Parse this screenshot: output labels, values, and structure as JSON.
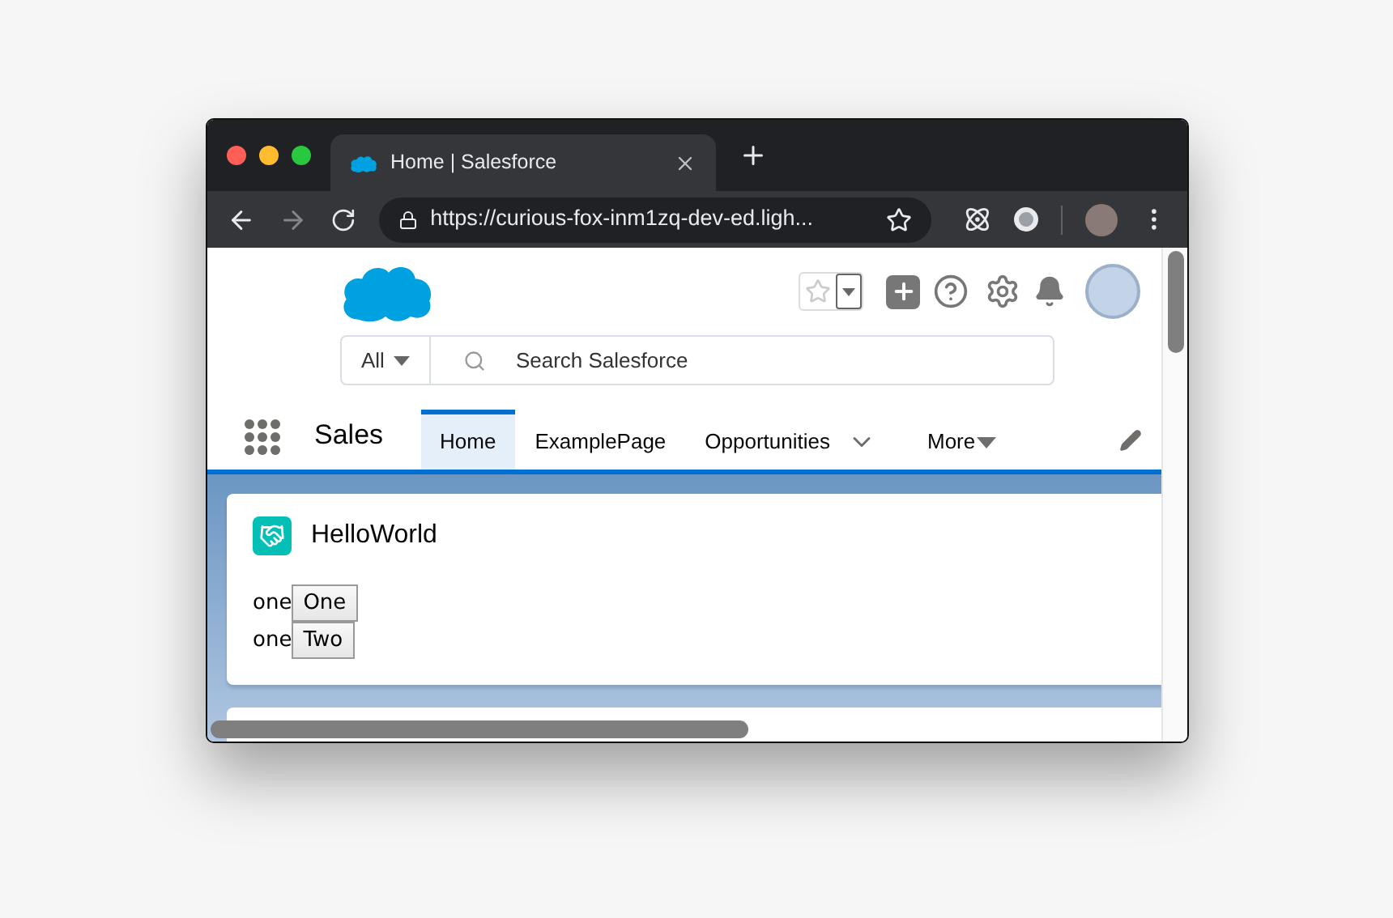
{
  "browser": {
    "tab": {
      "title": "Home | Salesforce",
      "selected": true
    },
    "address": "https://curious-fox-inm1zq-dev-ed.ligh..."
  },
  "header": {
    "search_scope": "All",
    "search_placeholder": "Search Salesforce"
  },
  "nav": {
    "app_name": "Sales",
    "tabs": [
      {
        "label": "Home",
        "selected": true,
        "kind": "tab"
      },
      {
        "label": "ExamplePage",
        "selected": false,
        "kind": "tab"
      },
      {
        "label": "Opportunities",
        "selected": false,
        "kind": "dropdown"
      },
      {
        "label": "More",
        "selected": false,
        "kind": "more"
      }
    ]
  },
  "cards": [
    {
      "title": "HelloWorld",
      "rows": [
        {
          "label": "one",
          "button": "One"
        },
        {
          "label": "one",
          "button": "Two"
        }
      ]
    }
  ]
}
